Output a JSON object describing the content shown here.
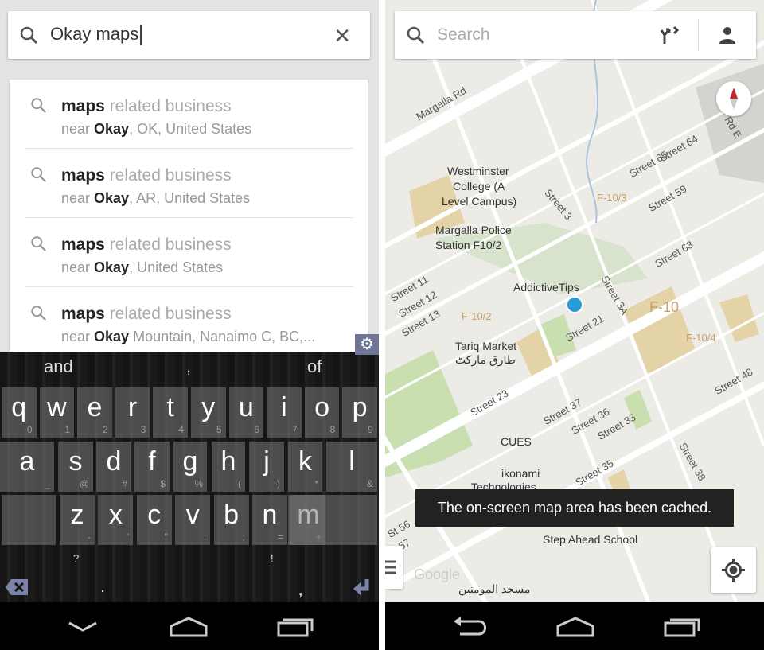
{
  "left": {
    "search": {
      "query": "Okay maps",
      "icon": "search-icon",
      "clear_icon": "close-icon"
    },
    "suggestions": [
      {
        "term": "maps",
        "rest": " related business",
        "near": "near ",
        "bold": "Okay",
        "place": ", OK, United States"
      },
      {
        "term": "maps",
        "rest": " related business",
        "near": "near ",
        "bold": "Okay",
        "place": ", AR, United States"
      },
      {
        "term": "maps",
        "rest": " related business",
        "near": "near ",
        "bold": "Okay",
        "place": ", United States"
      },
      {
        "term": "maps",
        "rest": " related business",
        "near": "near ",
        "bold": "Okay",
        "place": " Mountain, Nanaimo C, BC,..."
      }
    ],
    "keyboard": {
      "predictions": [
        "and",
        ",",
        "of"
      ],
      "row1": [
        [
          "q",
          "0"
        ],
        [
          "w",
          "1"
        ],
        [
          "e",
          "2"
        ],
        [
          "r",
          "3"
        ],
        [
          "t",
          "4"
        ],
        [
          "y",
          "5"
        ],
        [
          "u",
          "6"
        ],
        [
          "i",
          "7"
        ],
        [
          "o",
          "8"
        ],
        [
          "p",
          "9"
        ]
      ],
      "row2": [
        [
          "a",
          "_"
        ],
        [
          "s",
          "@"
        ],
        [
          "d",
          "#"
        ],
        [
          "f",
          "$"
        ],
        [
          "g",
          "%"
        ],
        [
          "h",
          "("
        ],
        [
          "j",
          ")"
        ],
        [
          "k",
          "*"
        ],
        [
          "l",
          "&"
        ]
      ],
      "row3": [
        [
          "z",
          "-"
        ],
        [
          "x",
          "'"
        ],
        [
          "c",
          "\""
        ],
        [
          "v",
          ":"
        ],
        [
          "b",
          ";"
        ],
        [
          "n",
          "="
        ],
        [
          "m",
          "+"
        ]
      ],
      "bottom": {
        "question": "?",
        "exclaim": "!",
        "period": ".",
        "comma": ","
      }
    }
  },
  "right": {
    "search": {
      "placeholder": "Search",
      "directions_icon": "directions-icon",
      "account_icon": "person-icon"
    },
    "map_labels": [
      "Margalla Rd",
      "Westminster",
      "College (A",
      "Level Campus)",
      "Margalla Police",
      "Station F10/2",
      "AddictiveTips",
      "Tariq Market",
      "طارق مارکٹ",
      "CUES",
      "ikonami",
      "Technologies",
      "Step Ahead School",
      "مسجد المومنين",
      "Street 65",
      "Street 64",
      "Street 59",
      "Street 63",
      "Street 3",
      "Street 3A",
      "Street 21",
      "Street 11",
      "Street 12",
      "Street 13",
      "Street 23",
      "Street 37",
      "Street 36",
      "Street 33",
      "Street 35",
      "Street 48",
      "Street 38",
      "St 56",
      "St 57",
      "F-10/3",
      "F-10/2",
      "F-10/4",
      "F-10",
      "Rd E",
      "Google"
    ],
    "toast": "The on-screen map area has been cached."
  },
  "colors": {
    "map_bg": "#ecebe6",
    "park": "#c9dfb0",
    "sand": "#e4d3a6",
    "pin": "#2a9bd9",
    "toast_bg": "#222222"
  }
}
